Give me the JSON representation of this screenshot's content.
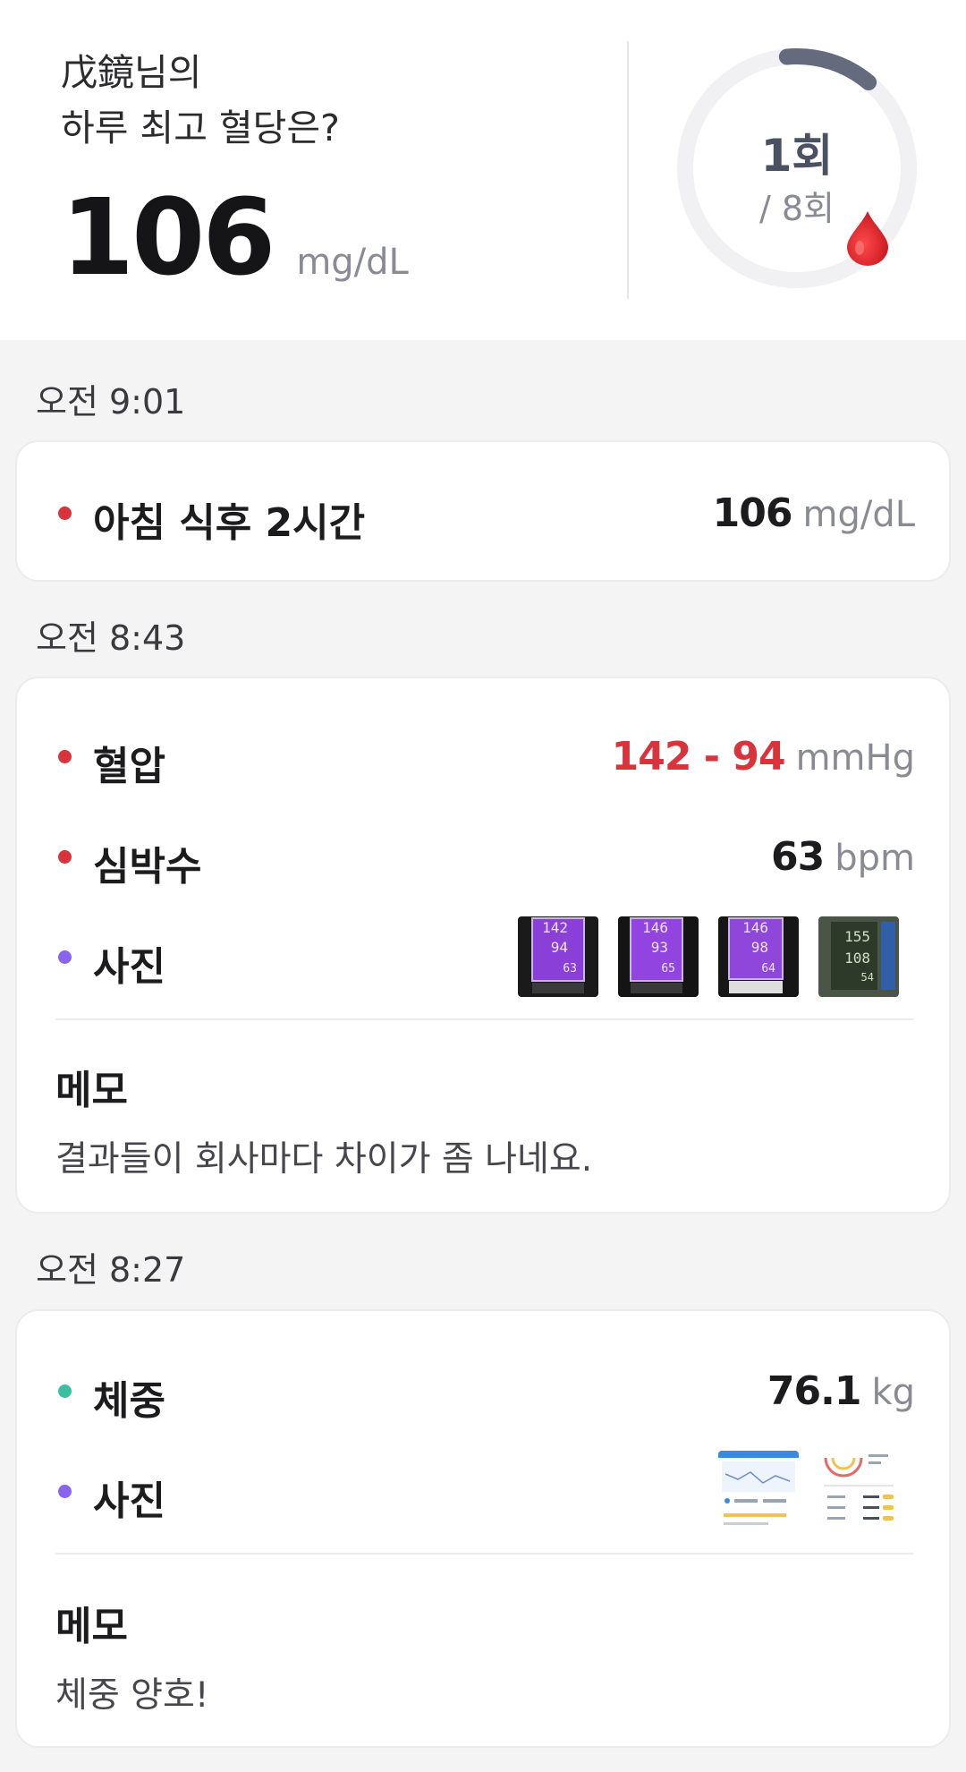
{
  "summary": {
    "greeting_line1": "戊鏡님의",
    "greeting_line2": "하루 최고 혈당은?",
    "value": "106",
    "unit": "mg/dL",
    "count": "1회",
    "total": "/ 8회",
    "progress_fraction": 0.125
  },
  "colors": {
    "red": "#d9343b",
    "green": "#3ac0a0",
    "purple": "#8a63ee",
    "ring_track": "#f1f1f3",
    "ring_progress": "#646b7c"
  },
  "entries": [
    {
      "time": "오전 9:01",
      "rows": [
        {
          "label": "아침 식후 2시간",
          "value": "106",
          "unit": "mg/dL",
          "dot": "red"
        }
      ]
    },
    {
      "time": "오전 8:43",
      "rows": [
        {
          "label": "혈압",
          "value": "142 - 94",
          "unit": "mmHg",
          "dot": "red",
          "highlight": true
        },
        {
          "label": "심박수",
          "value": "63",
          "unit": "bpm",
          "dot": "red"
        },
        {
          "label": "사진",
          "dot": "purple",
          "photos": [
            "142 94 63",
            "146 93 65",
            "146 98 64",
            "155 108 54"
          ]
        }
      ],
      "memo_title": "메모",
      "memo_text": "결과들이 회사마다 차이가 좀 나네요."
    },
    {
      "time": "오전 8:27",
      "rows": [
        {
          "label": "체중",
          "value": "76.1",
          "unit": "kg",
          "dot": "green"
        },
        {
          "label": "사진",
          "dot": "purple",
          "photos": [
            "weight chart screenshot",
            "scale app screenshot"
          ]
        }
      ],
      "memo_title": "메모",
      "memo_text": "체중 양호!"
    }
  ]
}
